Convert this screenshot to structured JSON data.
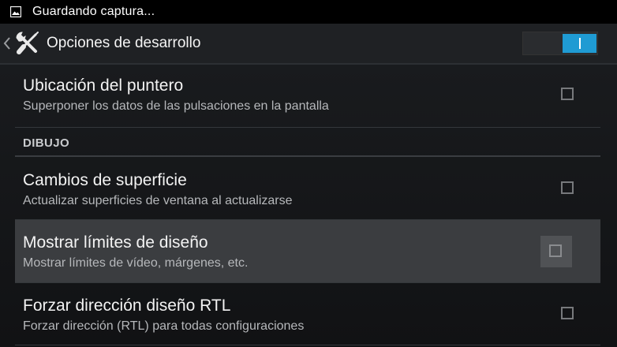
{
  "status_bar": {
    "notification_icon": "image-icon",
    "text": "Guardando captura..."
  },
  "action_bar": {
    "back_icon": "chevron-left-icon",
    "app_icon": "tools-icon",
    "title": "Opciones de desarrollo",
    "master_switch_state": "on"
  },
  "preferences": {
    "pointer_location": {
      "title": "Ubicación del puntero",
      "summary": "Superponer los datos de las pulsaciones en la pantalla",
      "checked": false
    },
    "section_drawing": {
      "label": "DIBUJO"
    },
    "surface_updates": {
      "title": "Cambios de superficie",
      "summary": "Actualizar superficies de ventana al actualizarse",
      "checked": false
    },
    "layout_bounds": {
      "title": "Mostrar límites de diseño",
      "summary": "Mostrar límites de vídeo, márgenes, etc.",
      "checked": false
    },
    "force_rtl": {
      "title": "Forzar dirección diseño RTL",
      "summary": "Forzar dirección (RTL) para todas configuraciones",
      "checked": false
    }
  },
  "colors": {
    "accent": "#1f9bd3",
    "pressed_row": "#3b3d40",
    "background": "#151618"
  }
}
